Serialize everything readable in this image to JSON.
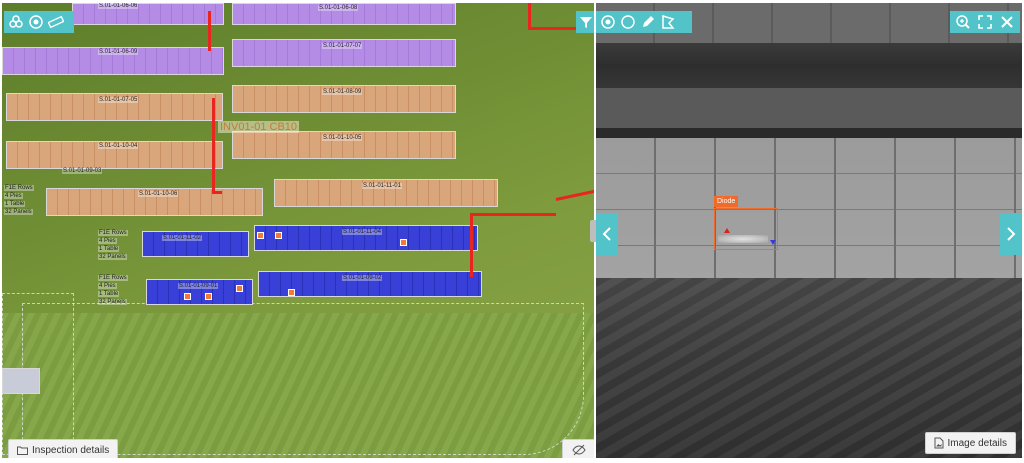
{
  "map": {
    "combiner_label": "INV01-01 CB10",
    "inspection_details_label": "Inspection details",
    "string_labels": [
      "S.01-01-06-06",
      "S.01-01-06-08",
      "S.01-01-06-09",
      "S.01-01-07-07",
      "S.01-01-07-05",
      "S.01-01-08-09",
      "S.01-01-10-04",
      "S.01-01-10-05",
      "S.01-01-10-06",
      "S.01-01-11-01",
      "S.01-01-11-02",
      "S.01-01-11-04"
    ],
    "inverter_labels": [
      "S.01-01-09-01",
      "S.01-01-09-02",
      "S.01-01-09-03"
    ],
    "side_notes": [
      "F1E Rows",
      "4 Pies",
      "1 Table",
      "32 Panels"
    ],
    "colors": {
      "purple_row": "#b48ce6",
      "orange_row": "#d9a57a",
      "blue_row": "#3840d8",
      "cable": "#e8251e",
      "anomaly": "#f07a3a",
      "toolbar": "#52c3c8"
    },
    "icons": {
      "tool_1": "panels-icon",
      "tool_2": "target-icon",
      "tool_3": "ruler-icon",
      "filter": "filter-icon",
      "hide": "visibility-off-icon",
      "folder": "folder-icon"
    }
  },
  "thermal": {
    "anomaly_tag": "Diode",
    "image_details_label": "Image details",
    "icons": {
      "target": "target-icon",
      "circle": "circle-icon",
      "pencil": "pencil-icon",
      "polygon": "polygon-icon",
      "zoom": "zoom-in-icon",
      "fullscreen": "fullscreen-icon",
      "close": "close-icon",
      "prev": "chevron-left-icon",
      "next": "chevron-right-icon",
      "image": "image-file-icon"
    }
  }
}
